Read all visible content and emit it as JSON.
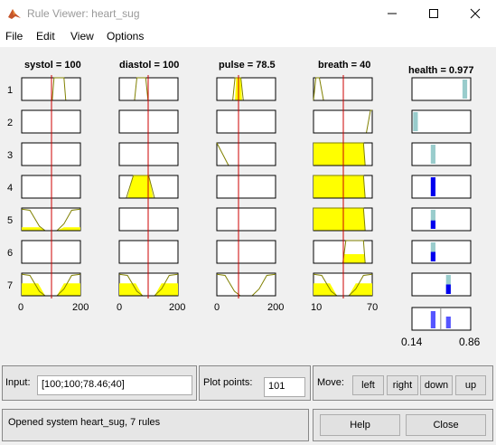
{
  "window": {
    "title": "Rule Viewer: heart_sug"
  },
  "menu": [
    "File",
    "Edit",
    "View",
    "Options"
  ],
  "inputs": [
    {
      "label": "systol = 100",
      "range_min": "0",
      "range_max": "200"
    },
    {
      "label": "diastol = 100",
      "range_min": "0",
      "range_max": "200"
    },
    {
      "label": "pulse = 78.5",
      "range_min": "0",
      "range_max": "200"
    },
    {
      "label": "breath = 40",
      "range_min": "10",
      "range_max": "70"
    }
  ],
  "output": {
    "label": "health = 0.977",
    "range_min": "0.14",
    "range_max": "0.86"
  },
  "rule_numbers": [
    "1",
    "2",
    "3",
    "4",
    "5",
    "6",
    "7"
  ],
  "controls": {
    "input_label": "Input:",
    "input_value": "[100;100;78.46;40]",
    "plot_points_label": "Plot points:",
    "plot_points_value": "101",
    "move_label": "Move:",
    "left": "left",
    "right": "right",
    "down": "down",
    "up": "up"
  },
  "status": "Opened system heart_sug, 7 rules",
  "help_label": "Help",
  "close_label": "Close",
  "colors": {
    "fill": "#ffff00",
    "index_line": "#cc0000",
    "output_fill": "#0000ee",
    "output_line": "#99cccc"
  }
}
